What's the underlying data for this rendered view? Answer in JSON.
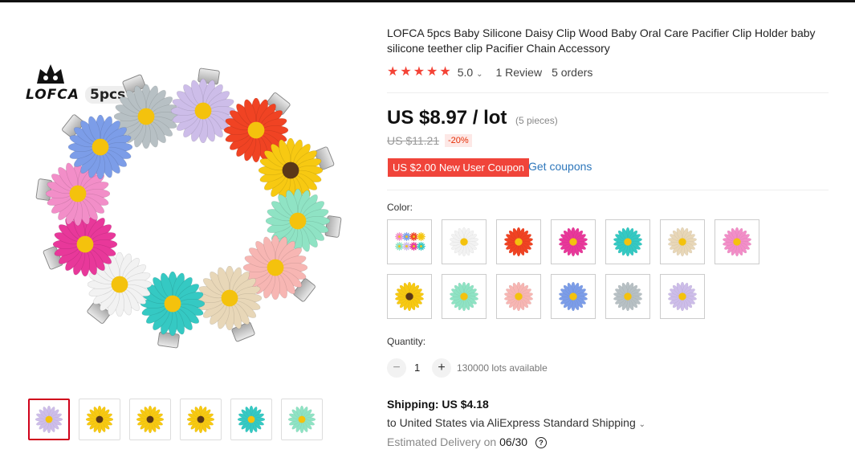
{
  "brand": {
    "name": "LOFCA",
    "pack_label": "5pcs"
  },
  "colors": {
    "accent": "#f44336",
    "link": "#2e77bb",
    "coupon_bg": "#f0443a",
    "price": "#111111"
  },
  "product": {
    "title": "LOFCA 5pcs Baby Silicone Daisy Clip Wood Baby Oral Care Pacifier Clip Holder baby silicone teether clip Pacifier Chain Accessory",
    "rating_stars": 5,
    "rating_value": "5.0",
    "reviews": "1 Review",
    "orders": "5 orders",
    "price": "US $8.97 / lot",
    "price_unit": "(5 pieces)",
    "old_price": "US $11.21",
    "discount": "-20%",
    "coupon": "US $2.00 New User Coupon",
    "get_coupons": "Get coupons"
  },
  "options": {
    "color_label": "Color:",
    "swatches": [
      {
        "name": "mixed",
        "petal": "#ccc",
        "center": "#f4c20d",
        "selected": false
      },
      {
        "name": "white",
        "petal": "#f2f2f2",
        "center": "#f4c20d"
      },
      {
        "name": "red",
        "petal": "#f04323",
        "center": "#f4c20d"
      },
      {
        "name": "rose",
        "petal": "#e8389a",
        "center": "#f4c20d"
      },
      {
        "name": "turquoise",
        "petal": "#35c9c3",
        "center": "#f4c20d"
      },
      {
        "name": "khaki",
        "petal": "#e8d7b8",
        "center": "#f4c20d"
      },
      {
        "name": "pink",
        "petal": "#f28ec8",
        "center": "#f4c20d"
      },
      {
        "name": "yellow",
        "petal": "#f7c912",
        "center": "#5a3818"
      },
      {
        "name": "mint",
        "petal": "#8fe3c4",
        "center": "#f4c20d"
      },
      {
        "name": "light-pink",
        "petal": "#f7b6b3",
        "center": "#f4c20d"
      },
      {
        "name": "blue",
        "petal": "#7c9de8",
        "center": "#f4c20d"
      },
      {
        "name": "gray",
        "petal": "#b7c0c4",
        "center": "#f4c20d"
      },
      {
        "name": "lavender",
        "petal": "#cdbde9",
        "center": "#f4c20d"
      }
    ],
    "quantity_label": "Quantity:",
    "quantity_value": "1",
    "minus": "−",
    "plus": "+",
    "available": "130000 lots available"
  },
  "shipping": {
    "title": "Shipping: US $4.18",
    "line": "to United States via AliExpress Standard Shipping",
    "delivery_prefix": "Estimated Delivery on",
    "delivery_date": "06/30",
    "help": "?"
  },
  "thumbnails": [
    {
      "name": "thumb-1",
      "active": true
    },
    {
      "name": "thumb-2",
      "active": false
    },
    {
      "name": "thumb-3",
      "active": false
    },
    {
      "name": "thumb-4",
      "active": false
    },
    {
      "name": "thumb-5",
      "active": false
    },
    {
      "name": "thumb-6",
      "active": false
    }
  ]
}
